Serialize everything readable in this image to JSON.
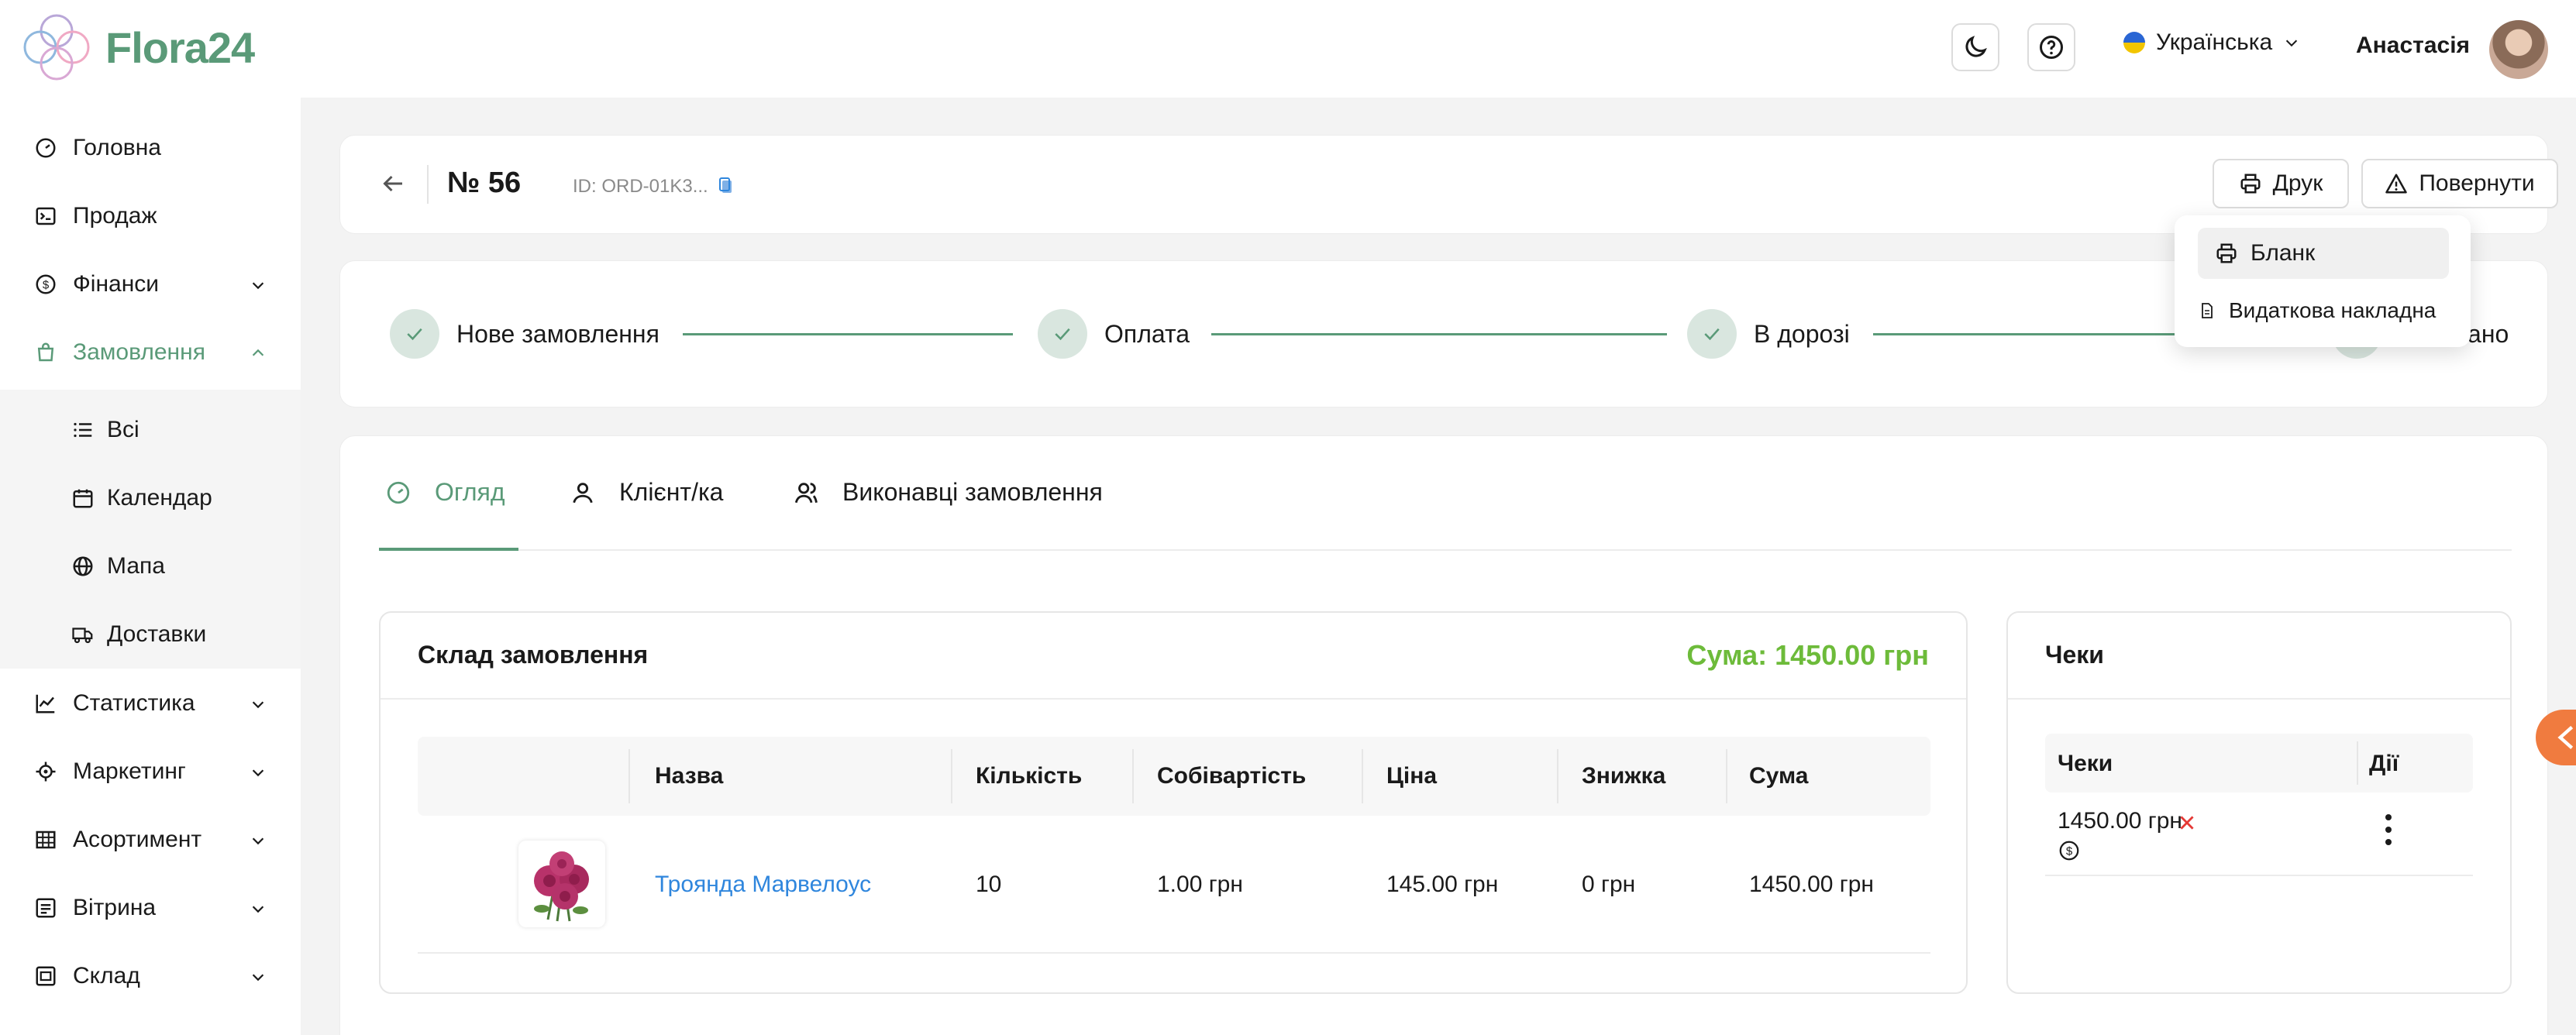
{
  "header": {
    "brand": "Flora24",
    "language": "Українська",
    "user_name": "Анастасія"
  },
  "sidebar": {
    "items": [
      {
        "label": "Головна",
        "icon": "dashboard-icon"
      },
      {
        "label": "Продаж",
        "icon": "terminal-icon"
      },
      {
        "label": "Фінанси",
        "icon": "dollar-icon"
      },
      {
        "label": "Замовлення",
        "icon": "bag-icon"
      },
      {
        "label": "Статистика",
        "icon": "chart-line-icon"
      },
      {
        "label": "Маркетинг",
        "icon": "target-icon"
      },
      {
        "label": "Асортимент",
        "icon": "grid-icon"
      },
      {
        "label": "Вітрина",
        "icon": "showcase-icon"
      },
      {
        "label": "Склад",
        "icon": "warehouse-icon"
      }
    ],
    "orders_sub": [
      {
        "label": "Всі",
        "icon": "list-icon"
      },
      {
        "label": "Календар",
        "icon": "calendar-icon"
      },
      {
        "label": "Мапа",
        "icon": "globe-icon"
      },
      {
        "label": "Доставки",
        "icon": "truck-icon"
      }
    ]
  },
  "order": {
    "number": "№ 56",
    "id": "ID: ORD-01K3...",
    "print_label": "Друк",
    "return_label": "Повернути"
  },
  "print_menu": {
    "items": [
      "Бланк",
      "Видаткова накладна"
    ]
  },
  "steps": [
    "Нове замовлення",
    "Оплата",
    "В дорозі",
    "Виконано"
  ],
  "tabs": [
    "Огляд",
    "Клієнт/ка",
    "Виконавці замовлення"
  ],
  "composition": {
    "title": "Склад замовлення",
    "total": "Сума: 1450.00 грн",
    "columns": [
      "Назва",
      "Кількість",
      "Собівартість",
      "Ціна",
      "Знижка",
      "Сума"
    ],
    "rows": [
      {
        "name": "Троянда Марвелоус",
        "qty": "10",
        "cost": "1.00 грн",
        "price": "145.00 грн",
        "discount": "0 грн",
        "sum": "1450.00 грн"
      }
    ]
  },
  "receipts": {
    "title": "Чеки",
    "columns": [
      "Чеки",
      "Дії"
    ],
    "rows": [
      {
        "amount": "1450.00 грн"
      }
    ]
  },
  "colors": {
    "accent": "#5a9a78",
    "total_green": "#6dbb3a",
    "link_blue": "#2f86dd",
    "danger": "#e53935",
    "handle_orange": "#f07b3f"
  }
}
